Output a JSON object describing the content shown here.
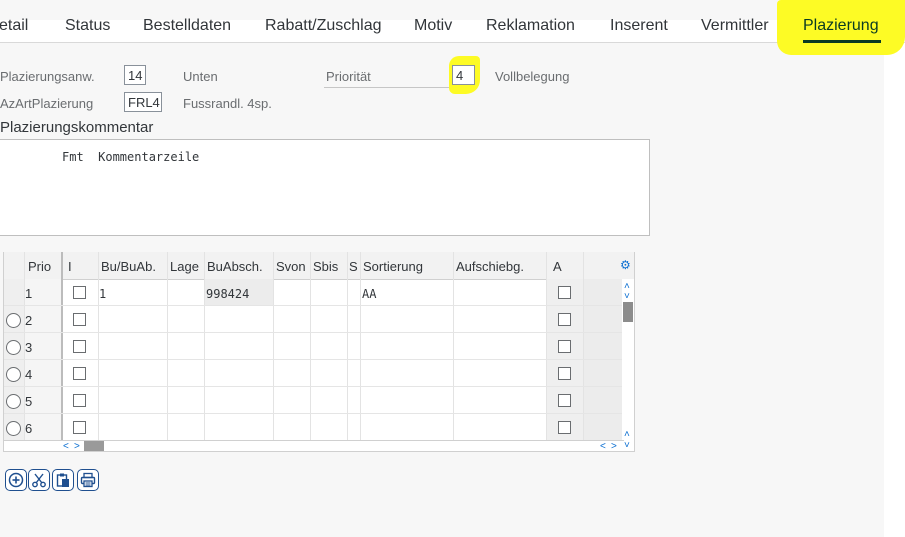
{
  "tabs": [
    {
      "label": "etail"
    },
    {
      "label": "Status"
    },
    {
      "label": "Bestelldaten"
    },
    {
      "label": "Rabatt/Zuschlag"
    },
    {
      "label": "Motiv"
    },
    {
      "label": "Reklamation"
    },
    {
      "label": "Inserent"
    },
    {
      "label": "Vermittler"
    },
    {
      "label": "Plazierung"
    }
  ],
  "form": {
    "placement_label": "Plazierungsanw.",
    "placement_value": "14",
    "placement_desc": "Unten",
    "priority_label": "Priorität",
    "priority_value": "4",
    "priority_desc": "Vollbelegung",
    "az_label": "AzArtPlazierung",
    "az_value": "FRL4",
    "az_desc": "Fussrandl. 4sp."
  },
  "comment": {
    "title": "Plazierungskommentar",
    "line": "Fmt  Kommentarzeile"
  },
  "table": {
    "headers": [
      "Prio",
      "I",
      "Bu/BuAb.",
      "Lage",
      "BuAbsch.",
      "Svon",
      "Sbis",
      "S",
      "Sortierung",
      "Aufschiebg.",
      "A"
    ],
    "rows": [
      {
        "prio": "1",
        "bu": "1",
        "buabsch": "998424",
        "sortierung": "AA"
      },
      {
        "prio": "2",
        "bu": "",
        "buabsch": "",
        "sortierung": ""
      },
      {
        "prio": "3",
        "bu": "",
        "buabsch": "",
        "sortierung": ""
      },
      {
        "prio": "4",
        "bu": "",
        "buabsch": "",
        "sortierung": ""
      },
      {
        "prio": "5",
        "bu": "",
        "buabsch": "",
        "sortierung": ""
      },
      {
        "prio": "6",
        "bu": "",
        "buabsch": "",
        "sortierung": ""
      }
    ]
  },
  "toolbar": {
    "icons": [
      "insert-row-icon",
      "cut-icon",
      "paste-icon",
      "print-icon"
    ]
  },
  "colors": {
    "highlight": "#fdfb25",
    "accent": "#0a6ed1",
    "active_tab_underline": "#0a3a23"
  }
}
